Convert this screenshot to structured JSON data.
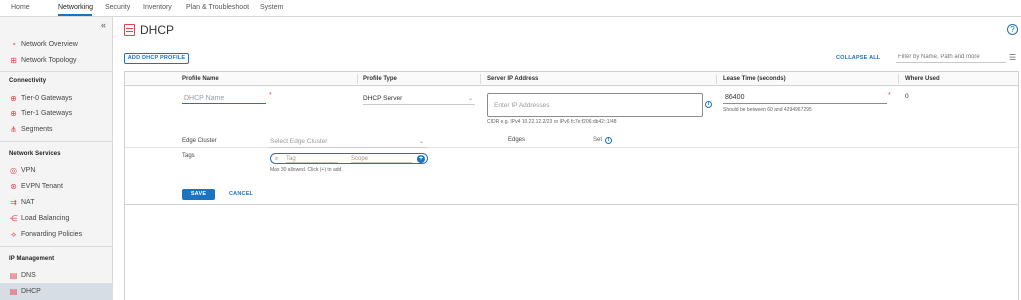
{
  "topnav": {
    "items": [
      "Home",
      "Networking",
      "Security",
      "Inventory",
      "Plan & Troubleshoot",
      "System"
    ],
    "active_index": 1
  },
  "sidebar": {
    "collapse_icon": "«",
    "group1": [
      {
        "label": "Network Overview",
        "icon": "network-overview-icon"
      },
      {
        "label": "Network Topology",
        "icon": "network-topology-icon"
      }
    ],
    "sections": {
      "connectivity": "Connectivity",
      "network_services": "Network Services",
      "ip_management": "IP Management"
    },
    "connectivity_items": [
      {
        "label": "Tier-0 Gateways",
        "icon": "tier0-gateway-icon"
      },
      {
        "label": "Tier-1 Gateways",
        "icon": "tier1-gateway-icon"
      },
      {
        "label": "Segments",
        "icon": "segments-icon"
      }
    ],
    "network_services_items": [
      {
        "label": "VPN",
        "icon": "vpn-icon"
      },
      {
        "label": "EVPN Tenant",
        "icon": "evpn-icon"
      },
      {
        "label": "NAT",
        "icon": "nat-icon"
      },
      {
        "label": "Load Balancing",
        "icon": "load-balancing-icon"
      },
      {
        "label": "Forwarding Policies",
        "icon": "forwarding-icon"
      }
    ],
    "ip_management_items": [
      {
        "label": "DNS",
        "icon": "dns-icon"
      },
      {
        "label": "DHCP",
        "icon": "dhcp-icon"
      }
    ],
    "active_label": "DHCP"
  },
  "page": {
    "title": "DHCP",
    "help": "?"
  },
  "toolbar": {
    "add_label": "ADD DHCP PROFILE",
    "collapse_all": "COLLAPSE ALL",
    "filter_placeholder": "Filter by Name, Path and more"
  },
  "grid": {
    "headers": [
      "Profile Name",
      "Profile Type",
      "Server IP Address",
      "Lease Time (seconds)",
      "Where Used"
    ],
    "row": {
      "name_placeholder": "DHCP Name",
      "required_mark": "*",
      "profile_type": "DHCP Server",
      "server_ip_placeholder": "Enter IP Addresses",
      "server_ip_hint": "CIDR e.g. IPv4 10.22.12.2/23 or IPv6 fc7e:f206:db42::1/48",
      "lease_time": "86400",
      "lease_hint": "Should be between 60 and 4294967295",
      "where_used": "0"
    },
    "detail": {
      "edge_cluster_label": "Edge Cluster",
      "edge_cluster_placeholder": "Select Edge Cluster",
      "edges_label": "Edges",
      "edges_value": "Set",
      "tags_label": "Tags",
      "tag_placeholder": "Tag",
      "scope_placeholder": "Scope",
      "tags_hint": "Max 30 allowed. Click (+) to add.",
      "save": "SAVE",
      "cancel": "CANCEL"
    }
  }
}
